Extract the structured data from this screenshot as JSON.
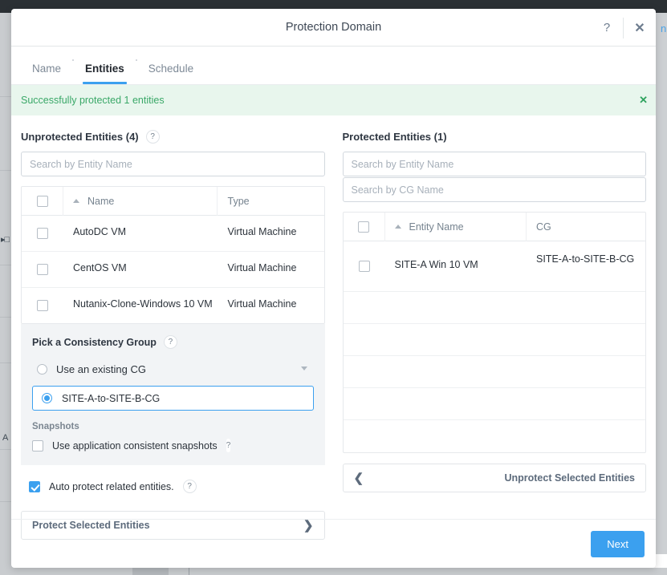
{
  "background": {
    "right_text": "n"
  },
  "modal": {
    "title": "Protection Domain",
    "help_icon": "?",
    "close_icon": "✕"
  },
  "tabs": [
    {
      "label": "Name",
      "active": false
    },
    {
      "label": "Entities",
      "active": true
    },
    {
      "label": "Schedule",
      "active": false
    }
  ],
  "banner": {
    "message": "Successfully protected 1 entities",
    "close_icon": "✕",
    "color": "#3aa868",
    "background": "#e8f6ed"
  },
  "unprotected": {
    "title": "Unprotected Entities (4)",
    "help": "?",
    "search_placeholder": "Search by Entity Name",
    "search_value": "",
    "columns": [
      "",
      "Name",
      "Type"
    ],
    "rows": [
      {
        "checked": false,
        "name": "AutoDC VM",
        "type": "Virtual Machine"
      },
      {
        "checked": false,
        "name": "CentOS VM",
        "type": "Virtual Machine"
      },
      {
        "checked": false,
        "name": "Nutanix-Clone-Windows 10 VM",
        "type": "Virtual Machine"
      }
    ]
  },
  "consistency_group": {
    "title": "Pick a Consistency Group",
    "help": "?",
    "existing_option": "Use an existing CG",
    "existing_selected": false,
    "selected_cg": "SITE-A-to-SITE-B-CG",
    "cg_selected": true,
    "snapshots_label": "Snapshots",
    "app_consistent_label": "Use application consistent snapshots",
    "app_consistent_checked": false,
    "app_consistent_help": "?"
  },
  "auto_protect": {
    "label": "Auto protect related entities.",
    "checked": true,
    "help": "?"
  },
  "protect_button": {
    "label": "Protect Selected Entities",
    "chevron": "❯"
  },
  "protected": {
    "title": "Protected Entities (1)",
    "search_entity_placeholder": "Search by Entity Name",
    "search_entity_value": "",
    "search_cg_placeholder": "Search by CG Name",
    "search_cg_value": "",
    "columns": [
      "",
      "Entity Name",
      "CG"
    ],
    "rows": [
      {
        "checked": false,
        "entity_name": "SITE-A Win 10 VM",
        "cg": "SITE-A-to-SITE-B-CG"
      }
    ],
    "empty_row_count": 5
  },
  "unprotect_button": {
    "label": "Unprotect Selected Entities",
    "chevron": "❮"
  },
  "footer": {
    "next_label": "Next",
    "accent": "#3ba0ef"
  }
}
